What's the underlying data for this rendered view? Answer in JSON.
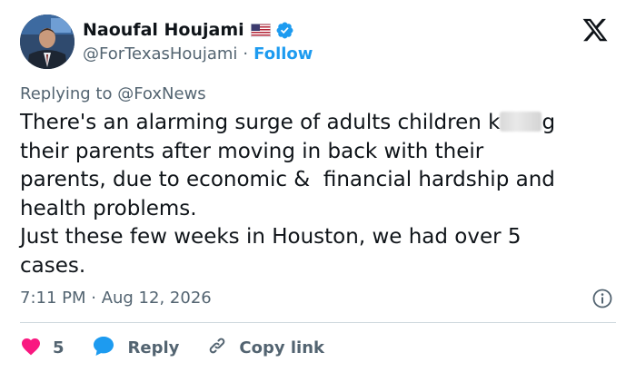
{
  "author": {
    "display_name": "Naoufal Houjami",
    "handle": "@ForTexasHoujami",
    "separator": "·",
    "follow_label": "Follow",
    "flag_icon": "us-flag-icon",
    "verified_icon": "verified-badge-icon",
    "verified_color": "#1d9bf0"
  },
  "platform_icon": "x-logo-icon",
  "replying": {
    "prefix": "Replying to",
    "mention": "@FoxNews"
  },
  "tweet": {
    "line1_before": "There's an alarming surge of adults children k",
    "line1_after": "g",
    "line2": "their parents after moving in back with their",
    "line3": "parents, due to economic &  financial hardship and",
    "line4": "health problems.",
    "line5": "Just these few weeks in Houston, we had over 5",
    "line6": "cases."
  },
  "timestamp": "7:11 PM · Aug 12, 2026",
  "actions": {
    "like_count": "5",
    "like_color": "#f91880",
    "reply_label": "Reply",
    "reply_color": "#1d9bf0",
    "copy_label": "Copy link"
  },
  "colors": {
    "text": "#0f1419",
    "secondary": "#536471",
    "accent": "#1d9bf0",
    "divider": "#cfd9de"
  }
}
